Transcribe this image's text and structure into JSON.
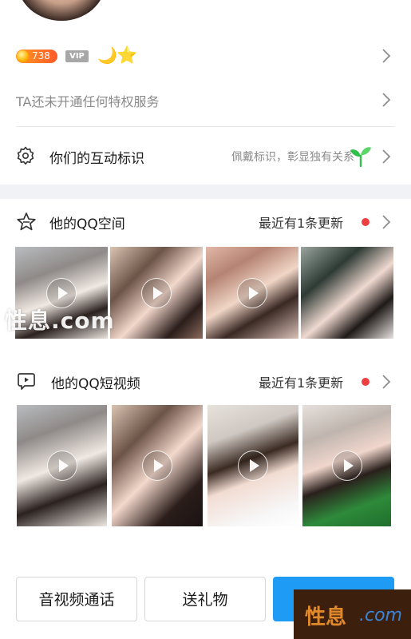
{
  "profile": {
    "level_badge": "738",
    "vip_badge": "VIP",
    "privilege_text": "TA还未开通任何特权服务"
  },
  "interaction": {
    "title": "你们的互动标识",
    "hint": "佩戴标识，彰显独有关系"
  },
  "qzone": {
    "title": "他的QQ空间",
    "update_text": "最近有1条更新"
  },
  "short_video": {
    "title": "他的QQ短视频",
    "update_text": "最近有1条更新"
  },
  "actions": {
    "av_call": "音视频通话",
    "send_gift": "送礼物"
  },
  "watermarks": {
    "overlay_text": "性息.com",
    "corner_text": "性息",
    "corner_domain": ".com"
  },
  "icons": {
    "accent_green": "#2fbf4a",
    "accent_red": "#ee3f3f",
    "primary_blue": "#1e9bf5"
  }
}
